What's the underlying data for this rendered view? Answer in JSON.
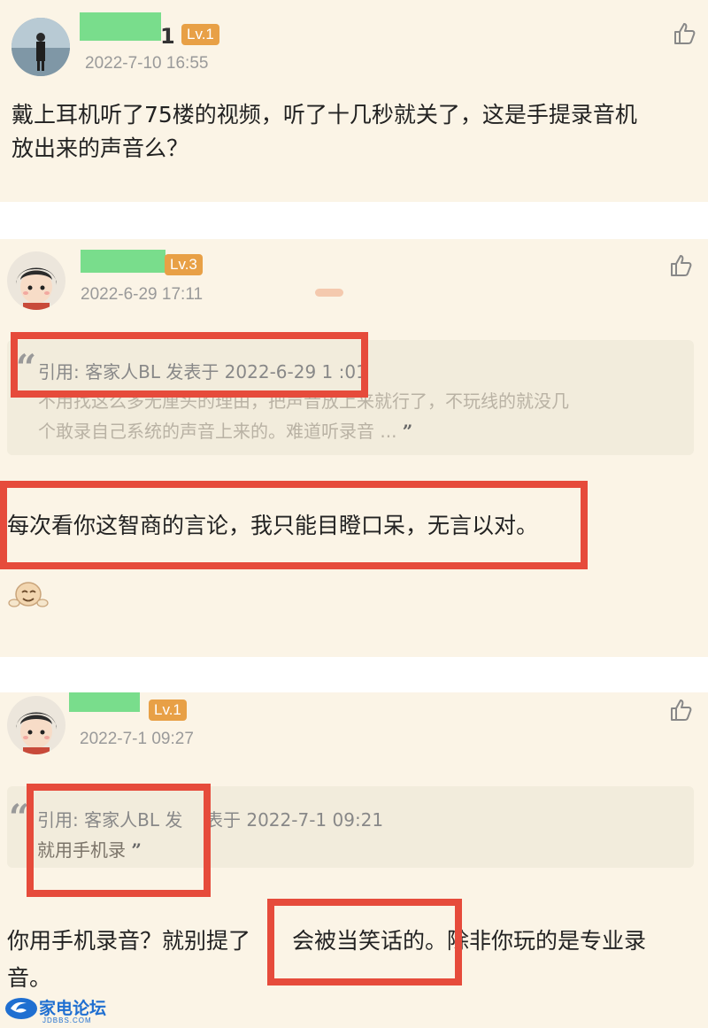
{
  "posts": [
    {
      "name_tail": "1",
      "level": "Lv.1",
      "time": "2022-7-10 16:55",
      "text_line1": "戴上耳机听了75楼的视频，听了十几秒就关了，这是手提录音机",
      "text_line2": "放出来的声音么？"
    },
    {
      "level": "Lv.3",
      "time": "2022-6-29 17:11",
      "quote_head": "引用: 客家人BL 发表于 2022-6-29 1 :01",
      "quote_line1": "不用找这么多无厘头的理由，把声音放上来就行了，不玩线的就没几",
      "quote_line2": "个敢录自己系统的声音上来的。难道听录音 ...",
      "text": "每次看你这智商的言论，我只能目瞪口呆，无言以对。"
    },
    {
      "level": "Lv.1",
      "time": "2022-7-1 09:27",
      "quote_head_a": "引用: 客家人BL 发",
      "quote_head_b": "表于 2022-7-1 09:21",
      "quote_line1": "就用手机录",
      "text_a": "你用手机录音？就别提了",
      "text_b": "会被当笑话的",
      "text_c": "。除非你玩的是专业录",
      "text_line2": "音。"
    }
  ],
  "watermark": {
    "site": "家电论坛",
    "domain": "JDBBS.COM"
  },
  "colors": {
    "card_bg": "#fbf4e6",
    "level_badge": "#e8a046",
    "highlight_box": "#e64b3b",
    "name_mask": "#79dd8c"
  },
  "icons": [
    "thumbs-up-icon",
    "quote-open-icon",
    "quote-close-icon",
    "laughing-emoji-icon",
    "jdbbs-logo-icon"
  ]
}
